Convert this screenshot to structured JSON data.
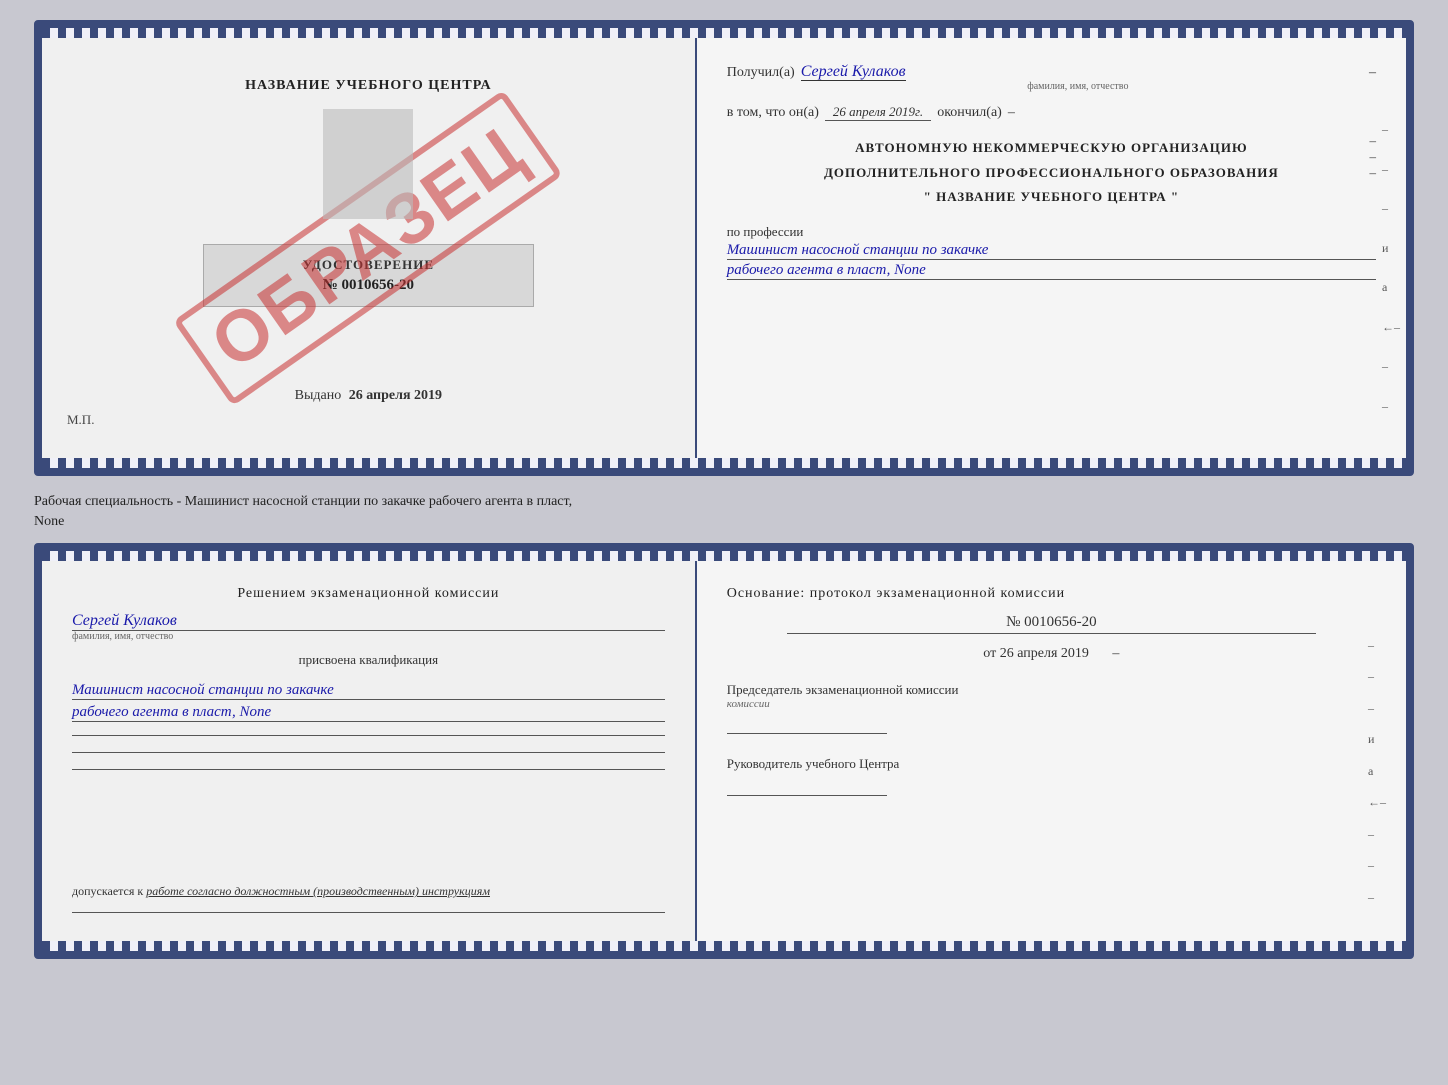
{
  "top_doc": {
    "left": {
      "title": "НАЗВАНИЕ УЧЕБНОГО ЦЕНТРА",
      "watermark": "ОБРАЗЕЦ",
      "udostoverenie_label": "УДОСТОВЕРЕНИЕ",
      "number": "№ 0010656-20",
      "vydano_label": "Выдано",
      "vydano_date": "26 апреля 2019",
      "mp": "М.П."
    },
    "right": {
      "poluchil_label": "Получил(а)",
      "poluchil_value": "Сергей Кулаков",
      "poluchil_sub": "фамилия, имя, отчество",
      "vtom_label": "в том, что он(а)",
      "vtom_value": "26 апреля 2019г.",
      "okonchil_label": "окончил(а)",
      "block_text1": "АВТОНОМНУЮ НЕКОММЕРЧЕСКУЮ ОРГАНИЗАЦИЮ",
      "block_text2": "ДОПОЛНИТЕЛЬНОГО ПРОФЕССИОНАЛЬНОГО ОБРАЗОВАНИЯ",
      "block_text3": "\"  НАЗВАНИЕ УЧЕБНОГО ЦЕНТРА  \"",
      "po_professii": "по профессии",
      "profession_line1": "Машинист насосной станции по закачке",
      "profession_line2": "рабочего агента в пласт, None"
    }
  },
  "middle": {
    "text": "Рабочая специальность - Машинист насосной станции по закачке рабочего агента в пласт,",
    "text2": "None"
  },
  "bottom_doc": {
    "left": {
      "resheniem": "Решением экзаменационной комиссии",
      "name": "Сергей Кулаков",
      "name_sub": "фамилия, имя, отчество",
      "prisvoena": "присвоена квалификация",
      "qual_line1": "Машинист насосной станции по закачке",
      "qual_line2": "рабочего агента в пласт, None",
      "dopusk_label": "допускается к",
      "dopusk_value": "работе согласно должностным (производственным) инструкциям"
    },
    "right": {
      "osnovanie": "Основание: протокол экзаменационной комиссии",
      "protocol_num": "№ 0010656-20",
      "ot_label": "от",
      "ot_date": "26 апреля 2019",
      "predsedatel_label": "Председатель экзаменационной комиссии",
      "rukovoditel_label": "Руководитель учебного Центра"
    }
  }
}
